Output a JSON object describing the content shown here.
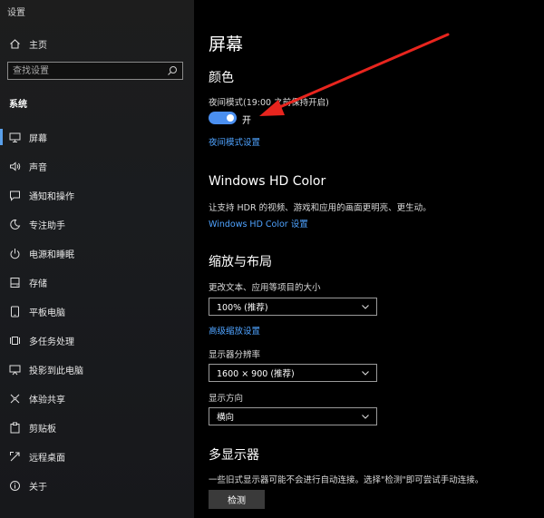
{
  "app": {
    "title": "设置"
  },
  "sidebar": {
    "home_label": "主页",
    "search_placeholder": "查找设置",
    "section_heading": "系统",
    "items": [
      {
        "label": "屏幕",
        "icon": "monitor-icon",
        "active": true
      },
      {
        "label": "声音",
        "icon": "speaker-icon"
      },
      {
        "label": "通知和操作",
        "icon": "notification-icon"
      },
      {
        "label": "专注助手",
        "icon": "moon-icon"
      },
      {
        "label": "电源和睡眠",
        "icon": "power-icon"
      },
      {
        "label": "存储",
        "icon": "storage-icon"
      },
      {
        "label": "平板电脑",
        "icon": "tablet-icon"
      },
      {
        "label": "多任务处理",
        "icon": "multitask-icon"
      },
      {
        "label": "投影到此电脑",
        "icon": "projection-icon"
      },
      {
        "label": "体验共享",
        "icon": "share-experience-icon"
      },
      {
        "label": "剪贴板",
        "icon": "clipboard-icon"
      },
      {
        "label": "远程桌面",
        "icon": "remote-desktop-icon"
      },
      {
        "label": "关于",
        "icon": "info-icon"
      }
    ],
    "accent": "#5aa0ea"
  },
  "main": {
    "page_title": "屏幕",
    "color_section": {
      "title": "颜色",
      "night_mode_label": "夜间模式(19:00 之前保持开启)",
      "toggle_state": "开",
      "night_mode_settings_link": "夜间模式设置"
    },
    "hd_color_section": {
      "title": "Windows HD Color",
      "description": "让支持 HDR 的视频、游戏和应用的画面更明亮、更生动。",
      "settings_link": "Windows HD Color 设置"
    },
    "scale_layout_section": {
      "title": "缩放与布局",
      "scale_label": "更改文本、应用等项目的大小",
      "scale_value": "100% (推荐)",
      "advanced_scaling_link": "高级缩放设置",
      "resolution_label": "显示器分辨率",
      "resolution_value": "1600 × 900 (推荐)",
      "orientation_label": "显示方向",
      "orientation_value": "横向"
    },
    "multi_display_section": {
      "title": "多显示器",
      "description": "一些旧式显示器可能不会进行自动连接。选择\"检测\"即可尝试手动连接。",
      "detect_button": "检测"
    },
    "toggle_color": "#4a8ff0",
    "link_color": "#4fa3ff",
    "annotation_arrow_color": "#e8251e"
  }
}
